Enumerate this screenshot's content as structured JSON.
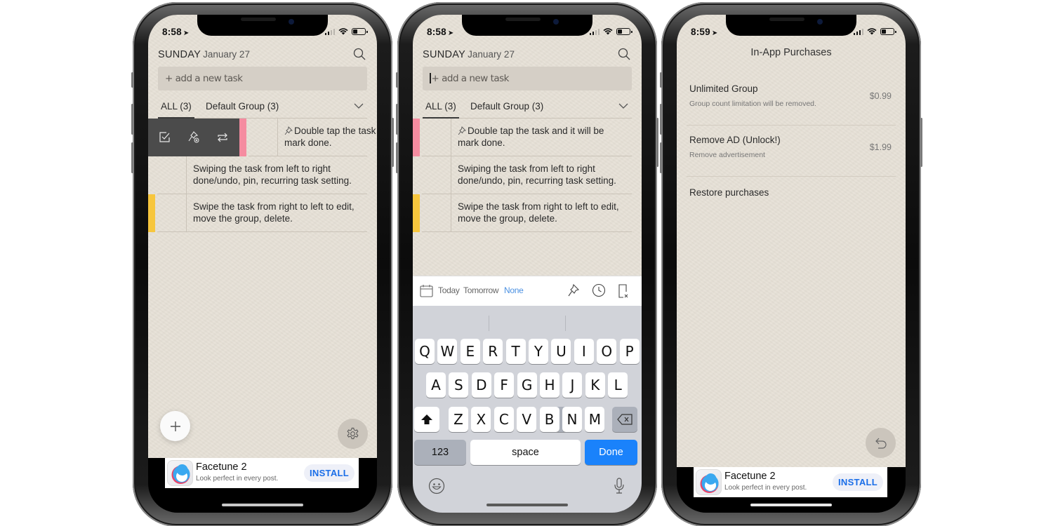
{
  "phones": [
    {
      "status": {
        "time": "8:58"
      },
      "header": {
        "day": "SUNDAY",
        "date": "January 27"
      },
      "add_task": {
        "placeholder": "+ add a new task"
      },
      "tabs": [
        {
          "label": "ALL (3)"
        },
        {
          "label": "Default Group (3)"
        }
      ],
      "tasks": [
        {
          "line1": "Double tap the task and it will be",
          "line2": "mark done.",
          "pinned": true,
          "color": "#f58ca0"
        },
        {
          "line1": "Swiping the task from left to right",
          "line2": "done/undo, pin, recurring task setting.",
          "pinned": false,
          "color": ""
        },
        {
          "line1": "Swipe the task from right to left to edit,",
          "line2": "move the group, delete.",
          "pinned": false,
          "color": "#f7c63d"
        }
      ],
      "swipe_actions": [
        "done-toggle",
        "unpin",
        "recurring"
      ]
    },
    {
      "status": {
        "time": "8:58"
      },
      "header": {
        "day": "SUNDAY",
        "date": "January 27"
      },
      "add_task": {
        "placeholder": "+ add a new task"
      },
      "tabs": [
        {
          "label": "ALL (3)"
        },
        {
          "label": "Default Group (3)"
        }
      ],
      "tasks": [
        {
          "line1": "Double tap the task and it will be",
          "line2": "mark done.",
          "pinned": true,
          "color": "#f58ca0"
        },
        {
          "line1": "Swiping the task from left to right",
          "line2": "done/undo, pin, recurring task setting.",
          "pinned": false,
          "color": ""
        },
        {
          "line1": "Swipe the task from right to left to edit,",
          "line2": "move the group, delete.",
          "pinned": false,
          "color": "#f7c63d"
        }
      ],
      "accessory": {
        "today": "Today",
        "tomorrow": "Tomorrow",
        "none": "None",
        "selected": "None"
      },
      "keyboard": {
        "row1": [
          "Q",
          "W",
          "E",
          "R",
          "T",
          "Y",
          "U",
          "I",
          "O",
          "P"
        ],
        "row2": [
          "A",
          "S",
          "D",
          "F",
          "G",
          "H",
          "J",
          "K",
          "L"
        ],
        "row3": [
          "Z",
          "X",
          "C",
          "V",
          "B",
          "N",
          "M"
        ],
        "numbers": "123",
        "space": "space",
        "done": "Done"
      }
    },
    {
      "status": {
        "time": "8:59"
      },
      "title": "In-App Purchases",
      "items": [
        {
          "title": "Unlimited Group",
          "subtitle": "Group count limitation will be removed.",
          "price": "$0.99"
        },
        {
          "title": "Remove AD (Unlock!)",
          "subtitle": "Remove advertisement",
          "price": "$1.99"
        }
      ],
      "restore": "Restore purchases"
    }
  ],
  "ad": {
    "name": "Facetune 2",
    "tagline": "Look perfect in every post.",
    "install": "INSTALL"
  },
  "colors": {
    "accent": "#1a82fb",
    "pink": "#f58ca0",
    "yellow": "#f7c63d",
    "paper": "#e6e0d6"
  }
}
